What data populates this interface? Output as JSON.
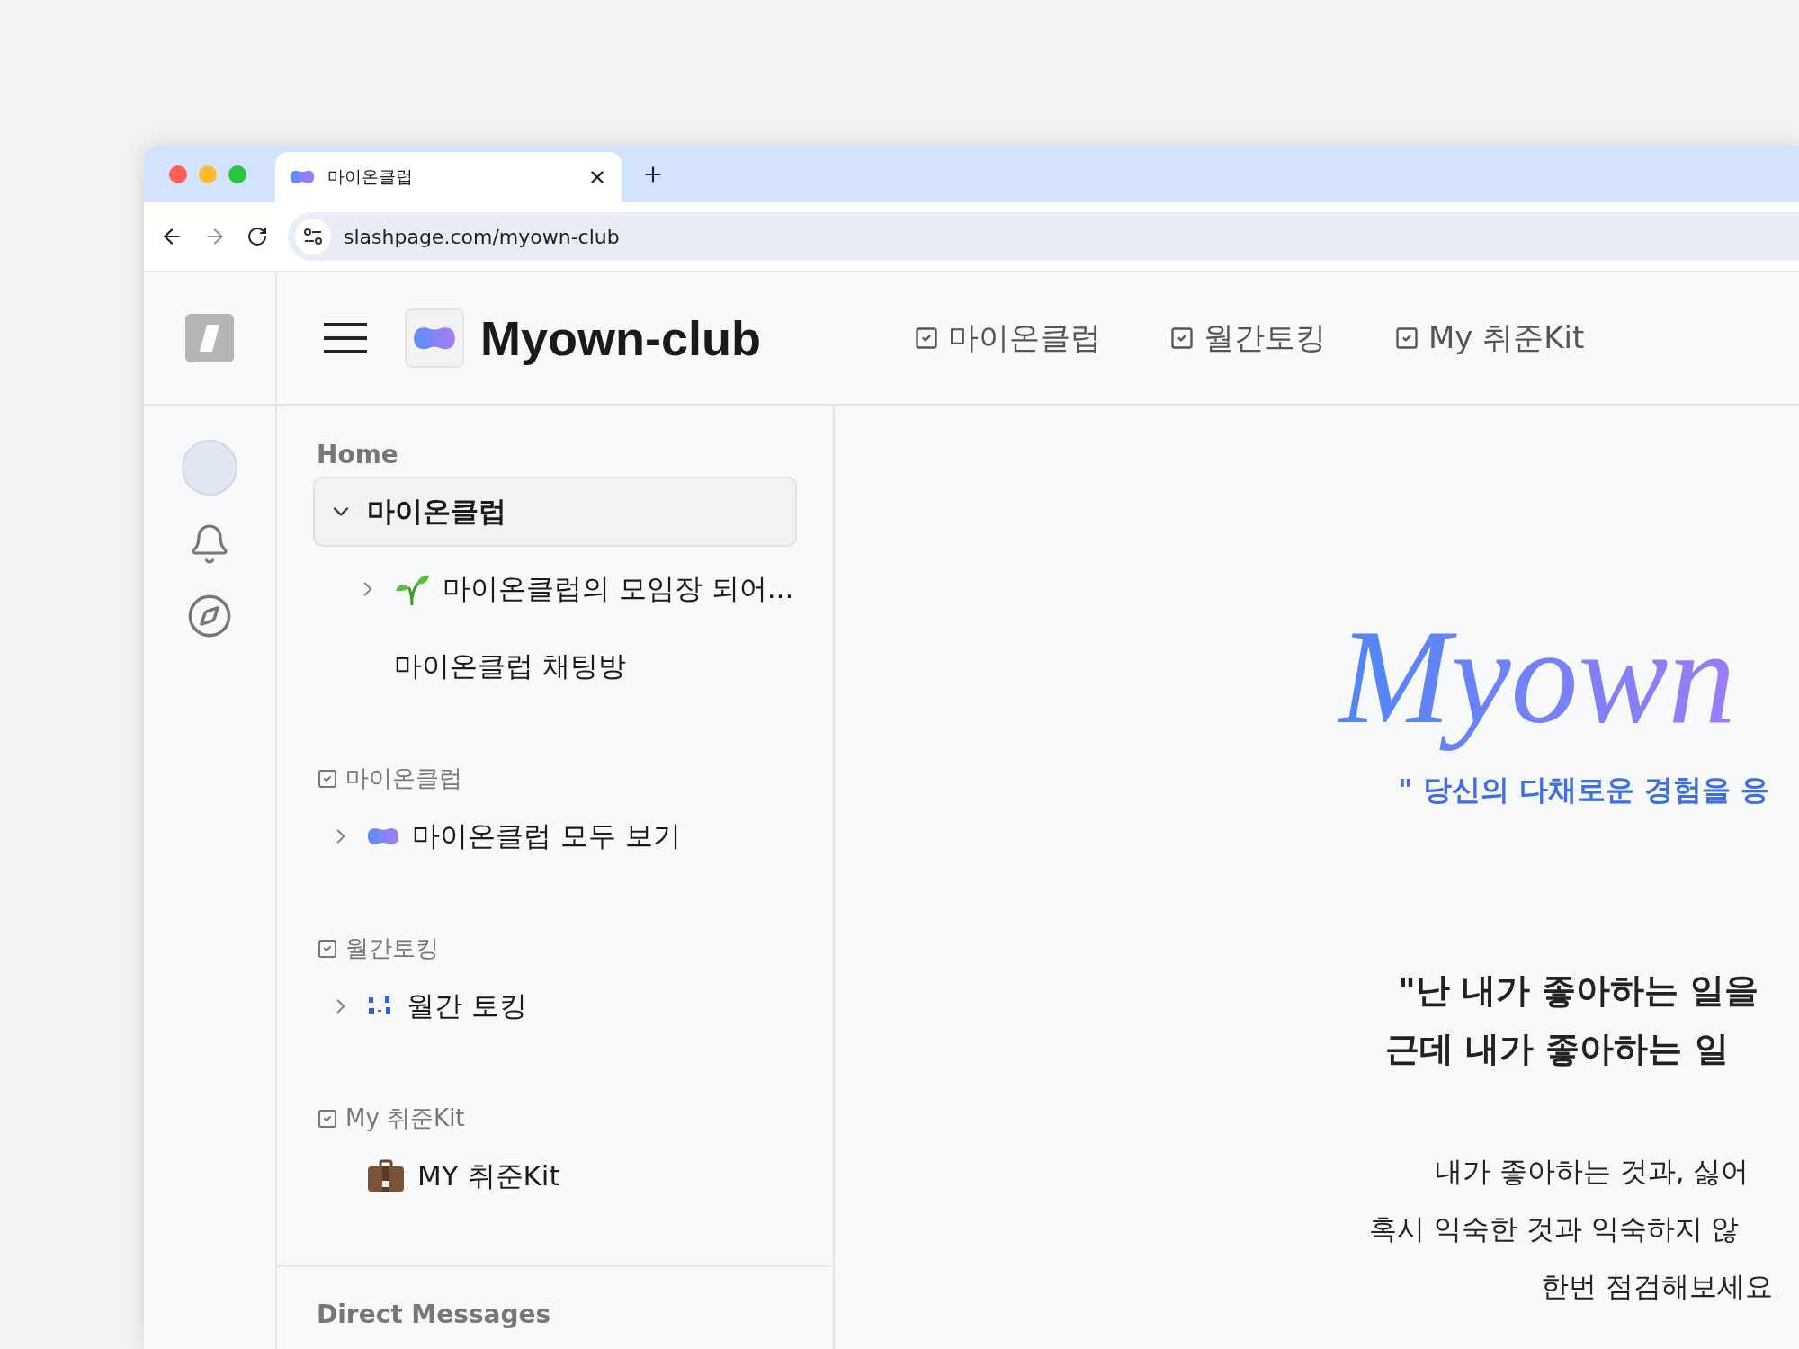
{
  "browser": {
    "tab_title": "마이온클럽",
    "url": "slashpage.com/myown-club"
  },
  "header": {
    "title": "Myown-club",
    "nav": [
      {
        "label": "마이온클럽"
      },
      {
        "label": "월간토킹"
      },
      {
        "label": "My 취준Kit"
      }
    ]
  },
  "sidebar": {
    "home": {
      "label": "Home",
      "items": [
        {
          "kind": "folder",
          "label": "마이온클럽",
          "selected": true,
          "expanded": true,
          "children": [
            {
              "kind": "folder",
              "label": "마이온클럽의 모임장 되어...",
              "expanded": false
            },
            {
              "kind": "page",
              "label": "마이온클럽 채팅방"
            }
          ]
        }
      ]
    },
    "sections": [
      {
        "label": "마이온클럽",
        "items": [
          {
            "kind": "folder",
            "label": "마이온클럽 모두 보기",
            "expanded": false
          }
        ]
      },
      {
        "label": "월간토킹",
        "items": [
          {
            "kind": "folder",
            "label": "월간 토킹",
            "expanded": false
          }
        ]
      },
      {
        "label": "My 취준Kit",
        "items": [
          {
            "kind": "page",
            "label": "MY 취준Kit"
          }
        ]
      }
    ],
    "direct_messages": {
      "label": "Direct Messages"
    }
  },
  "content": {
    "logo_text": "Myown",
    "tagline": "\" 당신의 다채로운 경험을 응",
    "heading": [
      "\"난 내가 좋아하는 일을",
      "근데 내가 좋아하는 일"
    ],
    "body": [
      "내가 좋아하는 것과, 싫어",
      "혹시 익숙한 것과 익숙하지 않",
      "한번 점검해보세요"
    ]
  }
}
